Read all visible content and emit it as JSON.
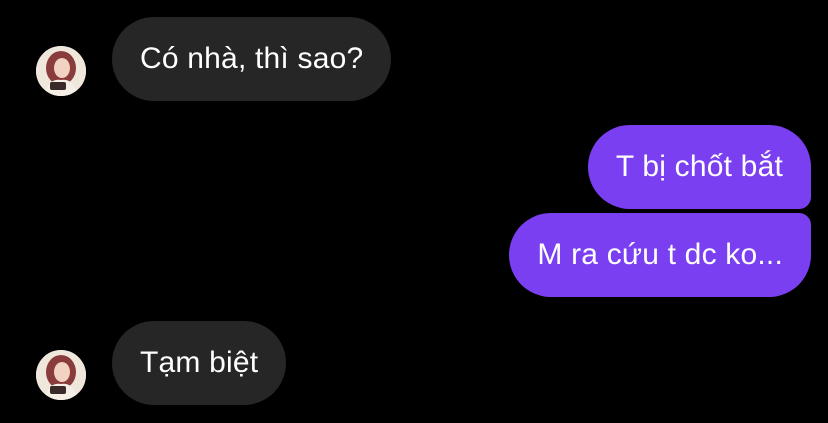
{
  "messages": [
    {
      "side": "incoming",
      "text": "Có nhà, thì sao?"
    },
    {
      "side": "outgoing",
      "text": "T bị chốt bắt"
    },
    {
      "side": "outgoing",
      "text": "M ra cứu t dc ko..."
    },
    {
      "side": "incoming",
      "text": "Tạm biệt"
    }
  ],
  "colors": {
    "background": "#000000",
    "incoming_bubble": "#262626",
    "outgoing_bubble": "#7b3ff2",
    "text": "#ffffff"
  }
}
